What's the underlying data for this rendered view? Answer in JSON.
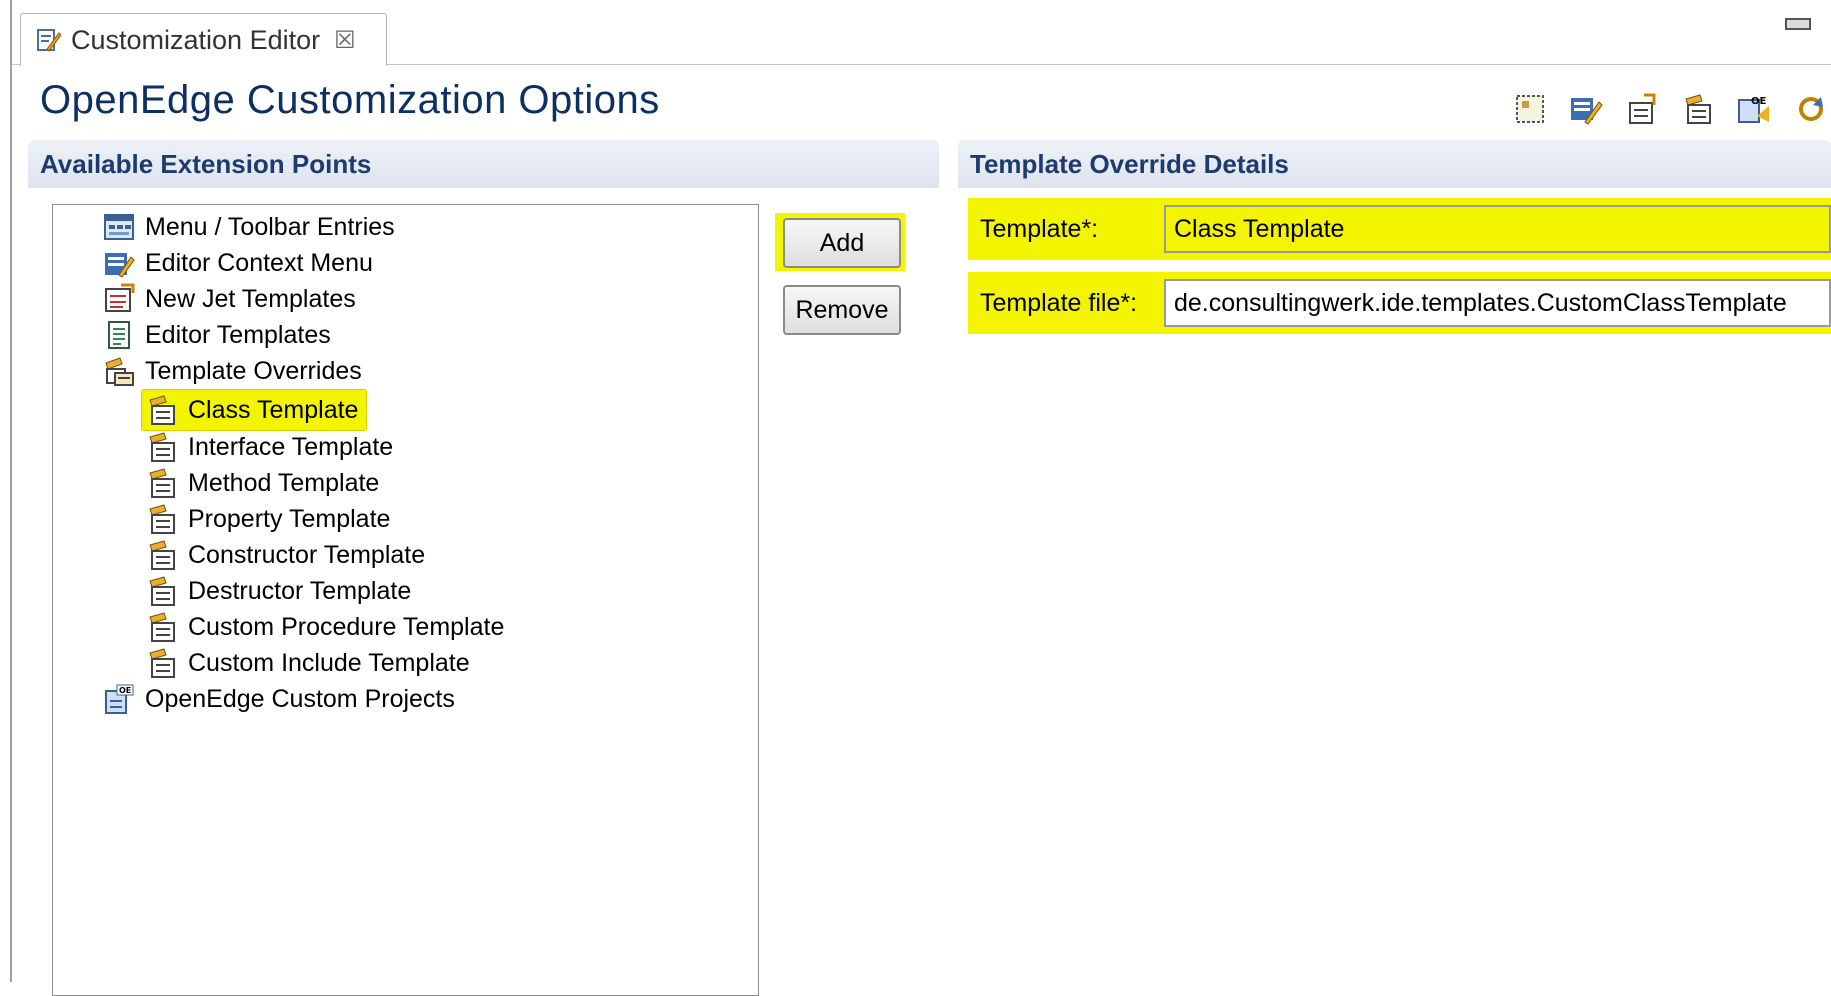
{
  "tab": {
    "label": "Customization Editor",
    "close_glyph": "☒",
    "icon": "editor-icon"
  },
  "page_title": "OpenEdge Customization Options",
  "toolbar": {
    "icons": [
      "grid-icon",
      "edit-icon",
      "export-icon",
      "template-icon",
      "project-icon",
      "refresh-icon"
    ]
  },
  "left_section": {
    "title": "Available Extension Points"
  },
  "right_section": {
    "title": "Template Override Details"
  },
  "tree": {
    "items": [
      {
        "label": "Menu / Toolbar Entries",
        "icon": "menu-toolbar-icon",
        "level": 0,
        "selected": false
      },
      {
        "label": "Editor Context Menu",
        "icon": "context-menu-icon",
        "level": 0,
        "selected": false
      },
      {
        "label": "New Jet Templates",
        "icon": "jet-template-icon",
        "level": 0,
        "selected": false
      },
      {
        "label": "Editor Templates",
        "icon": "editor-template-icon",
        "level": 0,
        "selected": false
      },
      {
        "label": "Template Overrides",
        "icon": "template-overrides-icon",
        "level": 0,
        "selected": false
      },
      {
        "label": "Class Template",
        "icon": "template-icon",
        "level": 1,
        "selected": true
      },
      {
        "label": "Interface Template",
        "icon": "template-icon",
        "level": 1,
        "selected": false
      },
      {
        "label": "Method Template",
        "icon": "template-icon",
        "level": 1,
        "selected": false
      },
      {
        "label": "Property Template",
        "icon": "template-icon",
        "level": 1,
        "selected": false
      },
      {
        "label": "Constructor Template",
        "icon": "template-icon",
        "level": 1,
        "selected": false
      },
      {
        "label": "Destructor Template",
        "icon": "template-icon",
        "level": 1,
        "selected": false
      },
      {
        "label": "Custom Procedure Template",
        "icon": "template-icon",
        "level": 1,
        "selected": false
      },
      {
        "label": "Custom Include Template",
        "icon": "template-icon",
        "level": 1,
        "selected": false
      },
      {
        "label": "OpenEdge Custom Projects",
        "icon": "custom-projects-icon",
        "level": 0,
        "selected": false
      }
    ]
  },
  "buttons": {
    "add": "Add",
    "remove": "Remove"
  },
  "details": {
    "template_label": "Template*:",
    "template_value": "Class Template",
    "file_label": "Template file*:",
    "file_value": "de.consultingwerk.ide.templates.CustomClassTemplate"
  },
  "colors": {
    "highlight": "#f3f400",
    "title": "#0d2f62",
    "section_title": "#1e3a6e"
  }
}
